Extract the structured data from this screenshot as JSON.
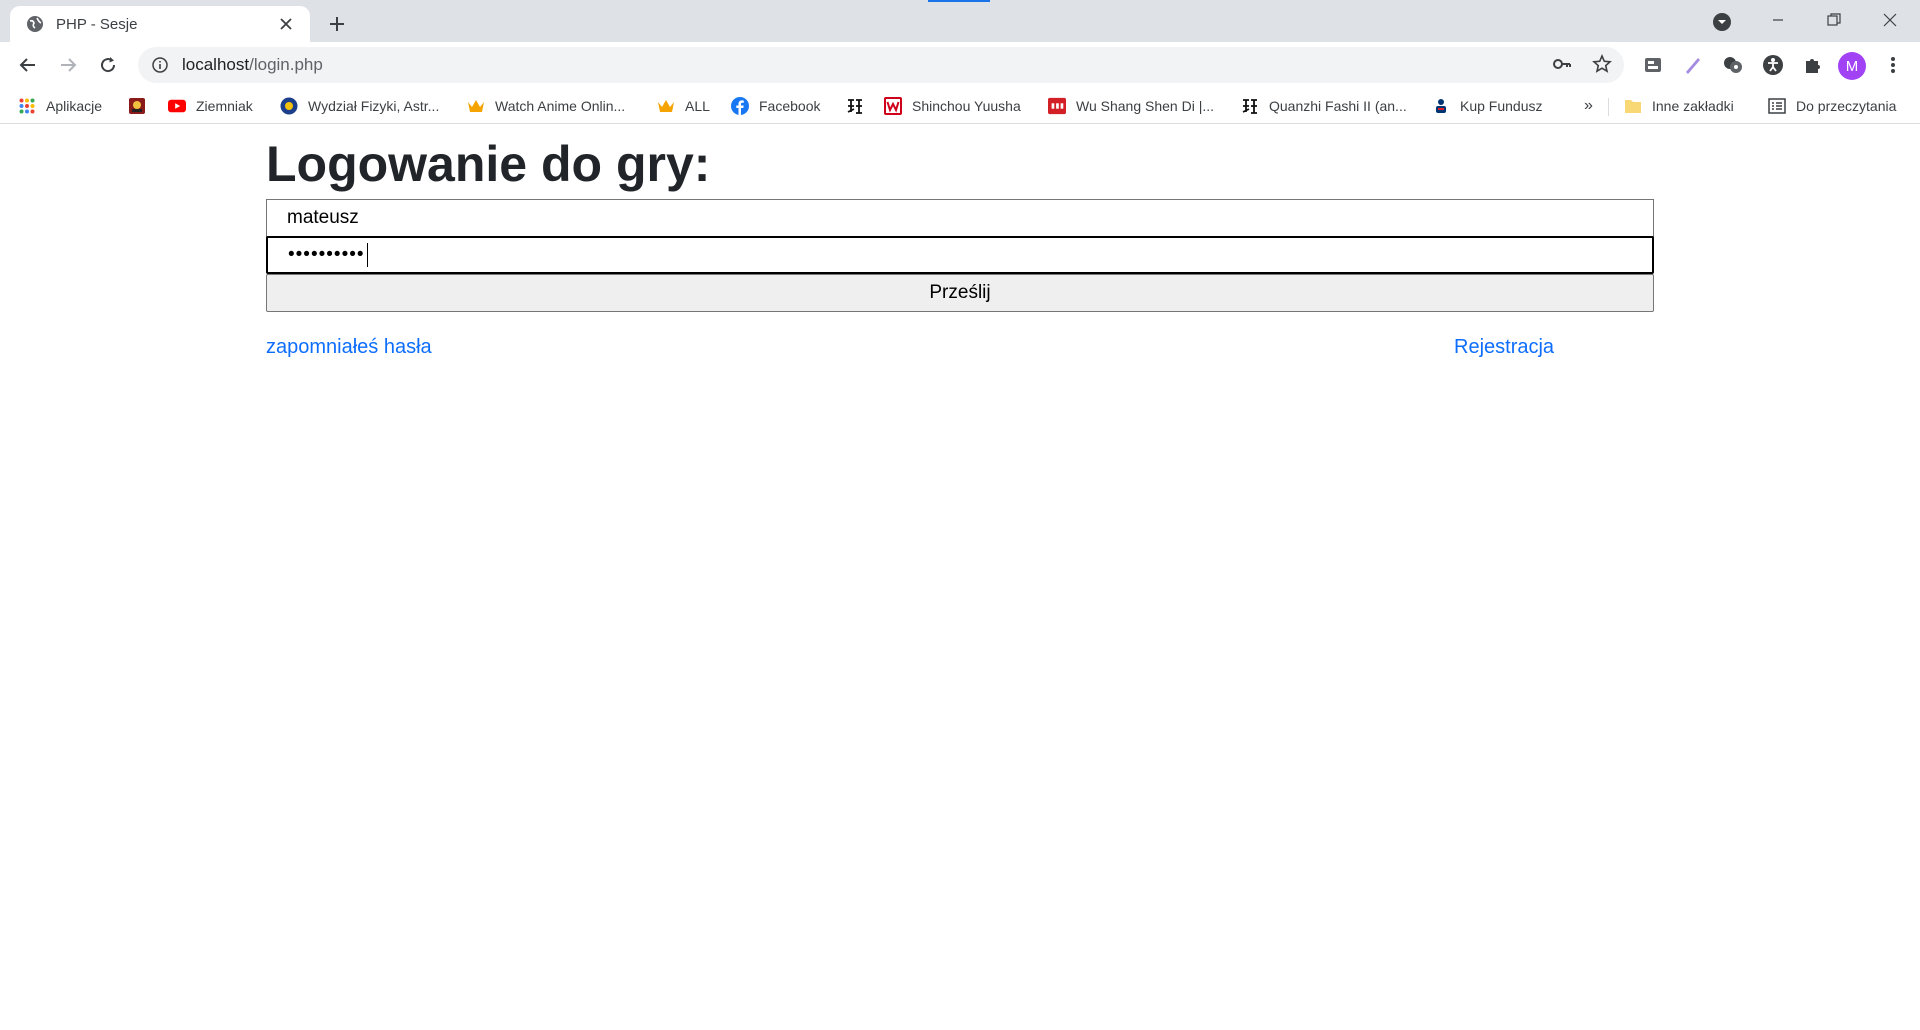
{
  "browser": {
    "tab": {
      "title": "PHP - Sesje"
    },
    "address": {
      "host": "localhost",
      "path": "/login.php"
    },
    "avatar_letter": "M",
    "colors": {
      "avatar": "#a142f4",
      "link": "#0d6efd"
    }
  },
  "bookmarks": {
    "items": [
      {
        "label": "Aplikacje",
        "icon": "apps-grid-icon"
      },
      {
        "label": "",
        "icon": "red-game-icon"
      },
      {
        "label": "Ziemniak",
        "icon": "youtube-icon"
      },
      {
        "label": "Wydział Fizyki, Astr...",
        "icon": "university-icon"
      },
      {
        "label": "Watch Anime Onlin...",
        "icon": "crown-icon"
      },
      {
        "label": "ALL",
        "icon": "crown-icon"
      },
      {
        "label": "Facebook",
        "icon": "facebook-icon"
      },
      {
        "label": "",
        "icon": "kanji-icon"
      },
      {
        "label": "Shinchou Yuusha",
        "icon": "w-icon"
      },
      {
        "label": "Wu Shang Shen Di |...",
        "icon": "cda-icon"
      },
      {
        "label": "Quanzhi Fashi II (an...",
        "icon": "kanji-icon"
      },
      {
        "label": "Kup Fundusz",
        "icon": "bank-icon"
      }
    ],
    "overflow": "»",
    "other": "Inne zakładki",
    "reading_list": "Do przeczytania"
  },
  "page": {
    "heading": "Logowanie do gry:",
    "username_value": "mateusz",
    "password_mask": "••••••••••",
    "submit_label": "Prześlij",
    "forgot_link": "zapomniałeś hasła",
    "register_link": "Rejestracja"
  }
}
